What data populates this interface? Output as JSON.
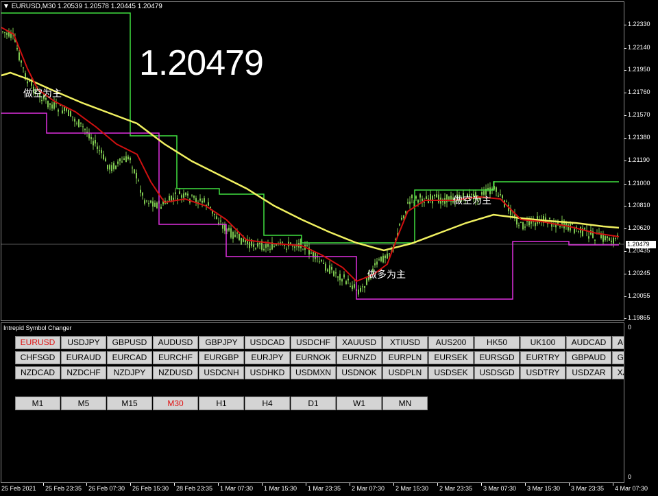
{
  "chart": {
    "header": "EURUSD,M30  1.20539 1.20578 1.20445 1.20479",
    "big_price": "1.20479",
    "current_price_tag": "1.20479",
    "labels": [
      "做空为主",
      "做多为主",
      "做空为主"
    ],
    "price_axis": [
      "1.22330",
      "1.22140",
      "1.21950",
      "1.21760",
      "1.21570",
      "1.21380",
      "1.21190",
      "1.21000",
      "1.20810",
      "1.20620",
      "1.20435",
      "1.20245",
      "1.20055",
      "1.19865"
    ],
    "time_axis": [
      "25 Feb 2021",
      "25 Feb 23:35",
      "26 Feb 07:30",
      "26 Feb 15:30",
      "28 Feb 23:35",
      "1 Mar 07:30",
      "1 Mar 15:30",
      "1 Mar 23:35",
      "2 Mar 07:30",
      "2 Mar 15:30",
      "2 Mar 23:35",
      "3 Mar 07:30",
      "3 Mar 15:30",
      "3 Mar 23:35",
      "4 Mar 07:30"
    ],
    "colors": {
      "candle": "#7ec850",
      "ma_fast": "#d01010",
      "ma_slow": "#f0f060",
      "channel_high": "#40e040",
      "channel_low": "#e030e0",
      "price_line": "#b0b0b0"
    }
  },
  "indicator": {
    "title": "Intrepid Symbol Changer",
    "scale_top": "0",
    "scale_bottom": "0",
    "symbols": [
      [
        "EURUSD",
        "USDJPY",
        "GBPUSD",
        "AUDUSD",
        "GBPJPY",
        "USDCAD",
        "USDCHF",
        "XAUUSD",
        "XTIUSD",
        "AUS200",
        "HK50",
        "UK100",
        "AUDCAD",
        "AUDCHF"
      ],
      [
        "CHFSGD",
        "EURAUD",
        "EURCAD",
        "EURCHF",
        "EURGBP",
        "EURJPY",
        "EURNOK",
        "EURNZD",
        "EURPLN",
        "EURSEK",
        "EURSGD",
        "EURTRY",
        "GBPAUD",
        "GBPCAD"
      ],
      [
        "NZDCAD",
        "NZDCHF",
        "NZDJPY",
        "NZDUSD",
        "USDCNH",
        "USDHKD",
        "USDMXN",
        "USDNOK",
        "USDPLN",
        "USDSEK",
        "USDSGD",
        "USDTRY",
        "USDZAR",
        "XAGUSD"
      ]
    ],
    "active_symbol": "EURUSD",
    "timeframes": [
      "M1",
      "M5",
      "M15",
      "M30",
      "H1",
      "H4",
      "D1",
      "W1",
      "MN"
    ],
    "active_timeframe": "M30"
  }
}
